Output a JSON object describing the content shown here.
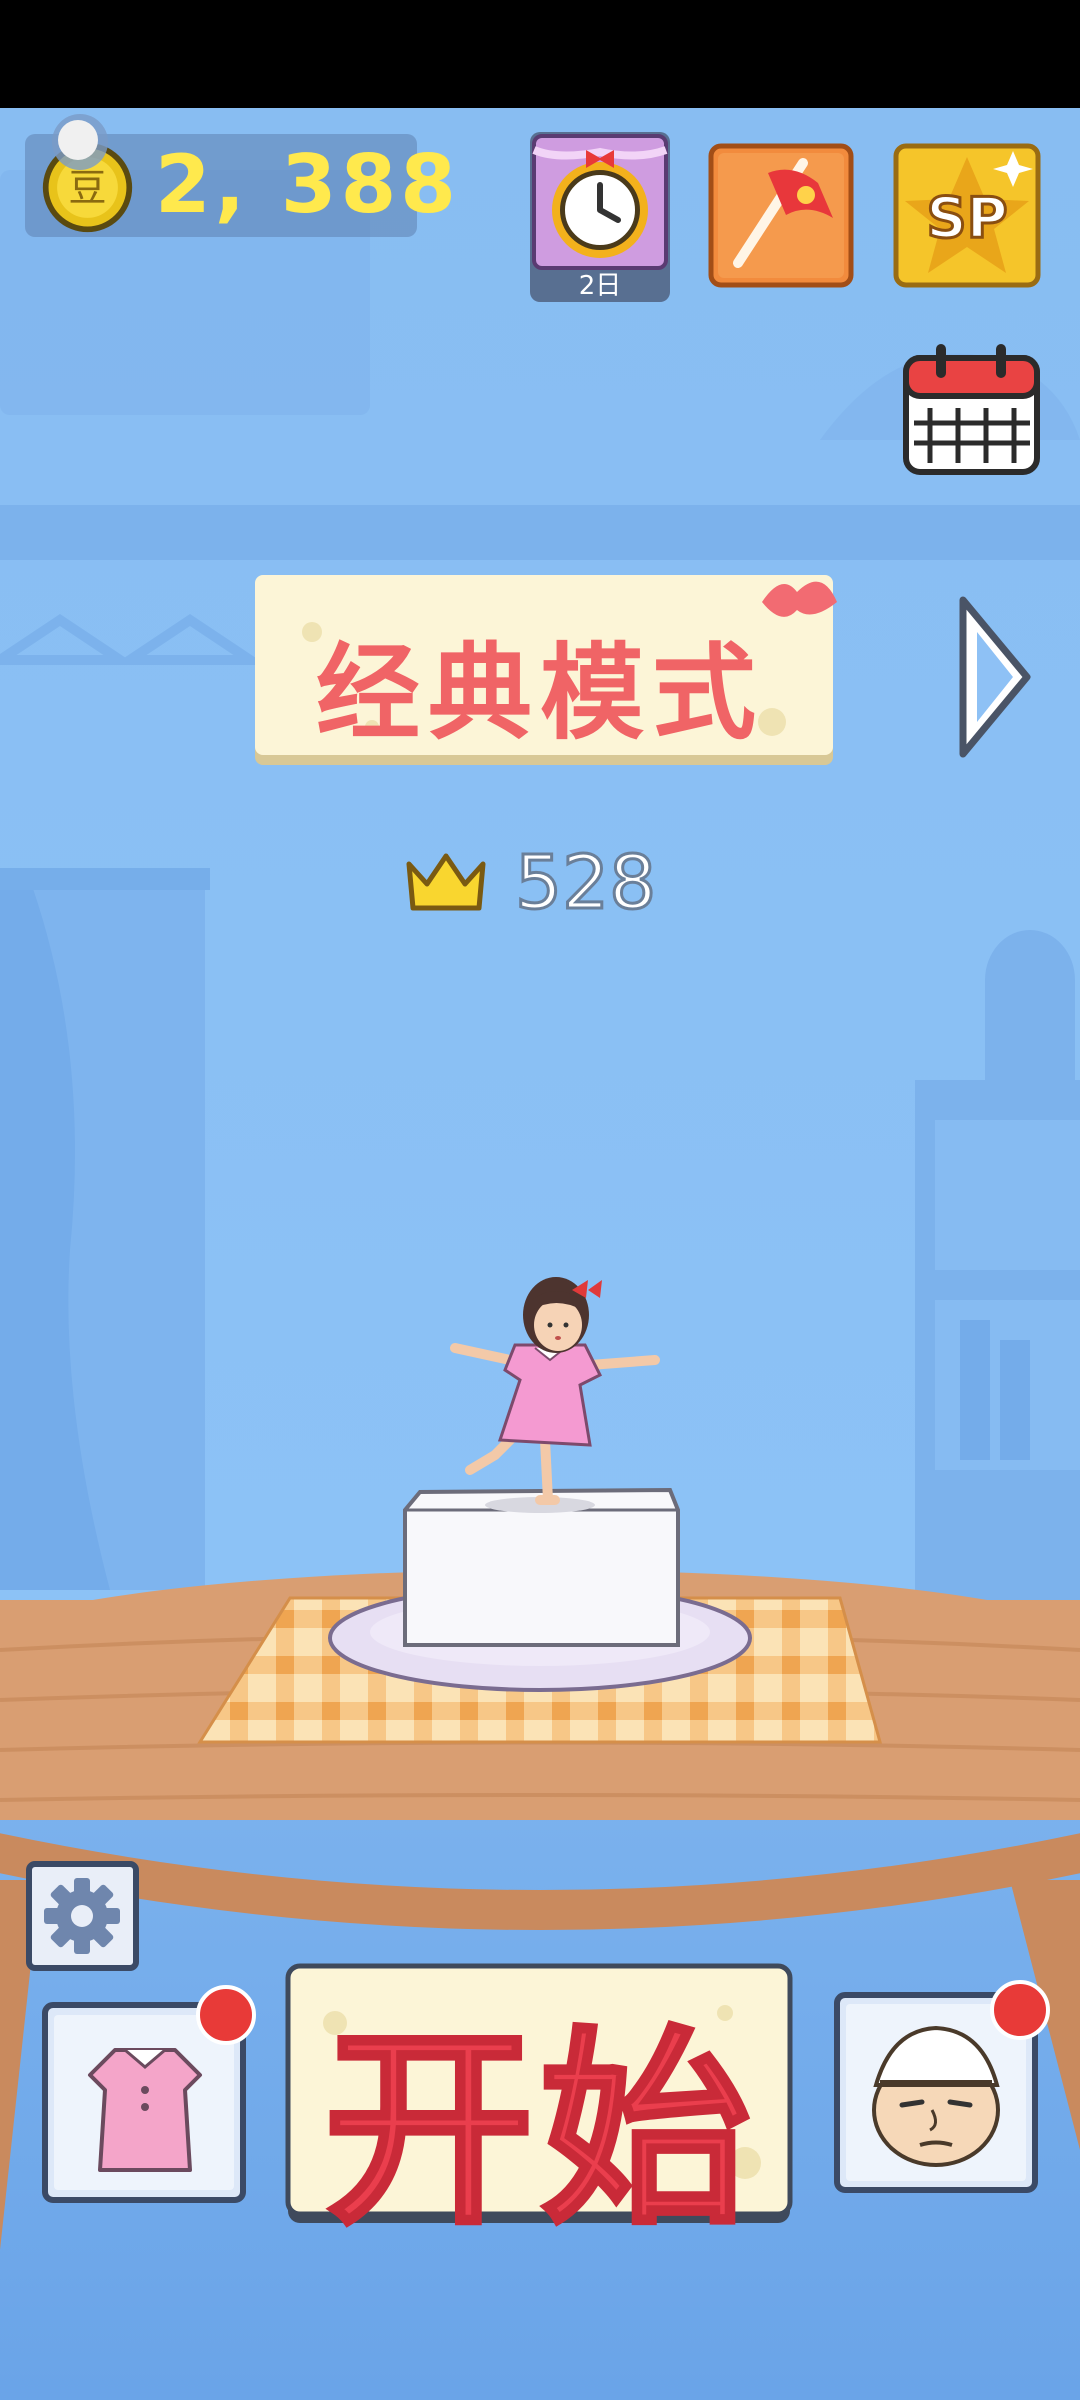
{
  "header": {
    "coins": "2, 388",
    "coin_glyph": "豆",
    "daily_label": "2日",
    "sp_label": "SP"
  },
  "mode": {
    "title": "经典模式"
  },
  "best_score": "528",
  "start_button": {
    "label": "开始"
  },
  "icons": {
    "coin": "coin-icon",
    "daily": "alarm-clock-icon",
    "flag": "flag-icon",
    "sp": "sp-star-icon",
    "calendar": "calendar-icon",
    "next": "chevron-right-icon",
    "crown": "crown-icon",
    "settings": "gear-icon",
    "outfit": "dress-icon",
    "character": "chef-face-icon"
  },
  "colors": {
    "sky": "#8ec1f5",
    "title_red": "#f06466",
    "start_red": "#ea3e4d",
    "coin_yellow": "#ffe94d",
    "badge_red": "#e83a38"
  }
}
